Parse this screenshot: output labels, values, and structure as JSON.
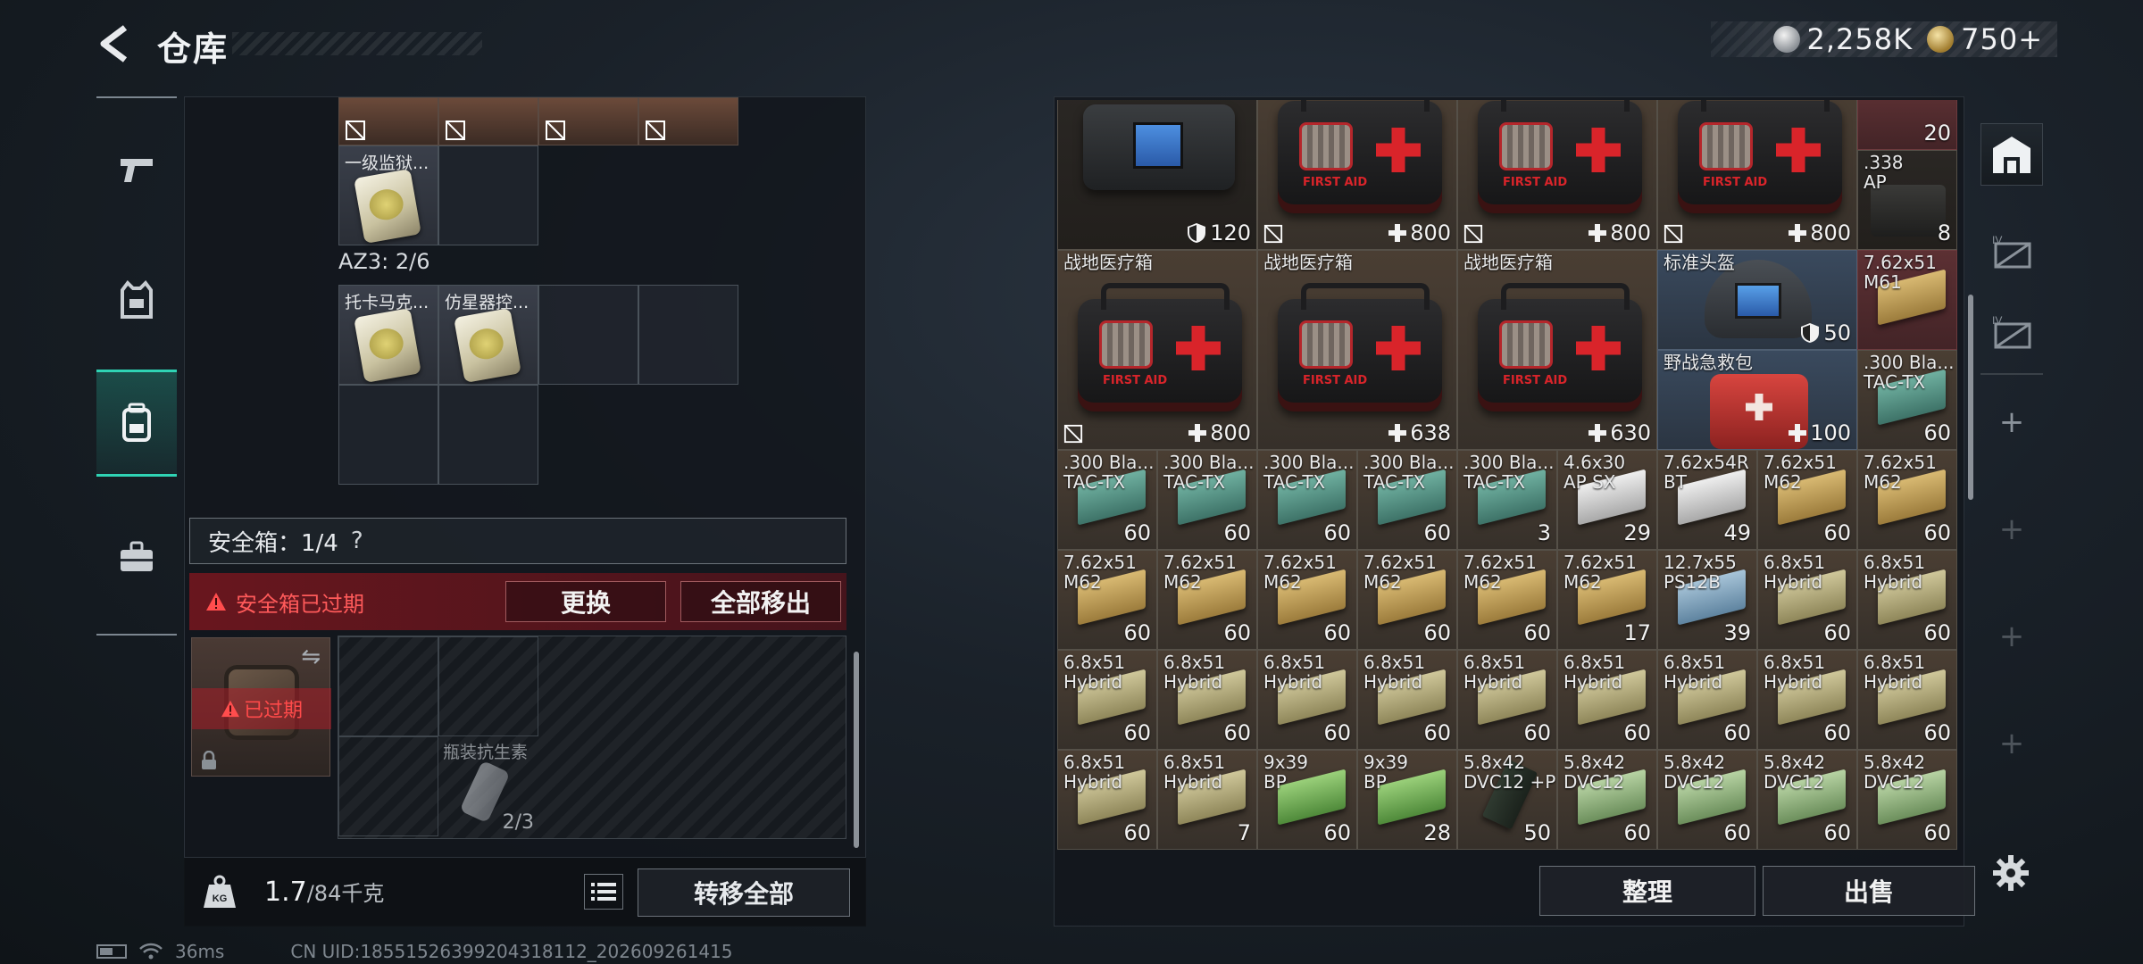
{
  "header": {
    "title": "仓库",
    "currency": [
      {
        "icon": "silver-coin-icon",
        "value": "2,258K"
      },
      {
        "icon": "gold-coin-icon",
        "value": "750+"
      }
    ]
  },
  "left_nav": [
    {
      "icon": "pistol-icon",
      "active": false
    },
    {
      "icon": "vest-icon",
      "active": false
    },
    {
      "icon": "backpack-icon",
      "active": true
    },
    {
      "icon": "briefcase-icon",
      "active": false
    }
  ],
  "container": {
    "top_slot_name": "一级监狱...",
    "az3_label": "AZ3: 2/6",
    "az3_items": [
      "托卡马克...",
      "仿星器控..."
    ],
    "safe_box_label": "安全箱：1/4",
    "safe_box_help": "?",
    "expired_warning": "安全箱已过期",
    "replace_button": "更换",
    "move_all_button": "全部移出",
    "safebox_expired_tag": "已过期",
    "antibiotic_name": "瓶装抗生素",
    "antibiotic_count": "2/3"
  },
  "weight": {
    "current": "1.7",
    "max": "/84千克"
  },
  "transfer_all_button": "转移全部",
  "status": {
    "ping": "36ms",
    "uid": "CN UID:18551526399204318112_202609261415"
  },
  "stash": {
    "row1": [
      {
        "label": "",
        "value": "120",
        "badge": "shield"
      },
      {
        "label": "",
        "value": "800",
        "badge": "plus"
      },
      {
        "label": "",
        "value": "800",
        "badge": "plus"
      },
      {
        "label": "",
        "value": "800",
        "badge": "plus"
      },
      {
        "label": "",
        "value": "20"
      },
      {
        "label": ".338\nAP",
        "value": "8"
      }
    ],
    "row2": [
      {
        "label": "战地医疗箱",
        "value": "800",
        "badge": "plus"
      },
      {
        "label": "战地医疗箱",
        "value": "638",
        "badge": "plus"
      },
      {
        "label": "战地医疗箱",
        "value": "630",
        "badge": "plus"
      },
      {
        "label": "标准头盔",
        "value": "50",
        "badge": "shield"
      },
      {
        "label": "7.62x51\nM61",
        "value": ""
      },
      {
        "label": "野战急救包",
        "value": "100",
        "badge": "plus"
      },
      {
        "label": ".300 Bla...\nTAC-TX",
        "value": "60"
      }
    ],
    "ammo": [
      {
        "label": ".300 Bla...\nTAC-TX",
        "value": "60"
      },
      {
        "label": ".300 Bla...\nTAC-TX",
        "value": "60"
      },
      {
        "label": ".300 Bla...\nTAC-TX",
        "value": "60"
      },
      {
        "label": ".300 Bla...\nTAC-TX",
        "value": "60"
      },
      {
        "label": ".300 Bla...\nTAC-TX",
        "value": "3"
      },
      {
        "label": "4.6x30\nAP SX",
        "value": "29"
      },
      {
        "label": "7.62x54R\nBT",
        "value": "49"
      },
      {
        "label": "7.62x51\nM62",
        "value": "60"
      },
      {
        "label": "7.62x51\nM62",
        "value": "60"
      },
      {
        "label": "7.62x51\nM62",
        "value": "60"
      },
      {
        "label": "7.62x51\nM62",
        "value": "60"
      },
      {
        "label": "7.62x51\nM62",
        "value": "60"
      },
      {
        "label": "7.62x51\nM62",
        "value": "60"
      },
      {
        "label": "7.62x51\nM62",
        "value": "60"
      },
      {
        "label": "7.62x51\nM62",
        "value": "17"
      },
      {
        "label": "12.7x55\nPS12B",
        "value": "39"
      },
      {
        "label": "6.8x51\nHybrid",
        "value": "60"
      },
      {
        "label": "6.8x51\nHybrid",
        "value": "60"
      },
      {
        "label": "6.8x51\nHybrid",
        "value": "60"
      },
      {
        "label": "6.8x51\nHybrid",
        "value": "60"
      },
      {
        "label": "6.8x51\nHybrid",
        "value": "60"
      },
      {
        "label": "6.8x51\nHybrid",
        "value": "60"
      },
      {
        "label": "6.8x51\nHybrid",
        "value": "60"
      },
      {
        "label": "6.8x51\nHybrid",
        "value": "60"
      },
      {
        "label": "6.8x51\nHybrid",
        "value": "60"
      },
      {
        "label": "6.8x51\nHybrid",
        "value": "60"
      },
      {
        "label": "6.8x51\nHybrid",
        "value": "60"
      },
      {
        "label": "6.8x51\nHybrid",
        "value": "60"
      },
      {
        "label": "6.8x51\nHybrid",
        "value": "7"
      },
      {
        "label": "9x39\nBP",
        "value": "60"
      },
      {
        "label": "9x39\nBP",
        "value": "28"
      },
      {
        "label": "5.8x42\nDVC12 +P",
        "value": "50"
      },
      {
        "label": "5.8x42\nDVC12",
        "value": "60"
      },
      {
        "label": "5.8x42\nDVC12",
        "value": "60"
      },
      {
        "label": "5.8x42\nDVC12",
        "value": "60"
      },
      {
        "label": "5.8x42\nDVC12",
        "value": "60"
      }
    ]
  },
  "sort_button": "整理",
  "sell_button": "出售",
  "rail": [
    "storage-icon",
    "crate-iv-icon",
    "crate-iv-icon",
    "add-icon",
    "add-icon",
    "add-icon",
    "add-icon"
  ]
}
